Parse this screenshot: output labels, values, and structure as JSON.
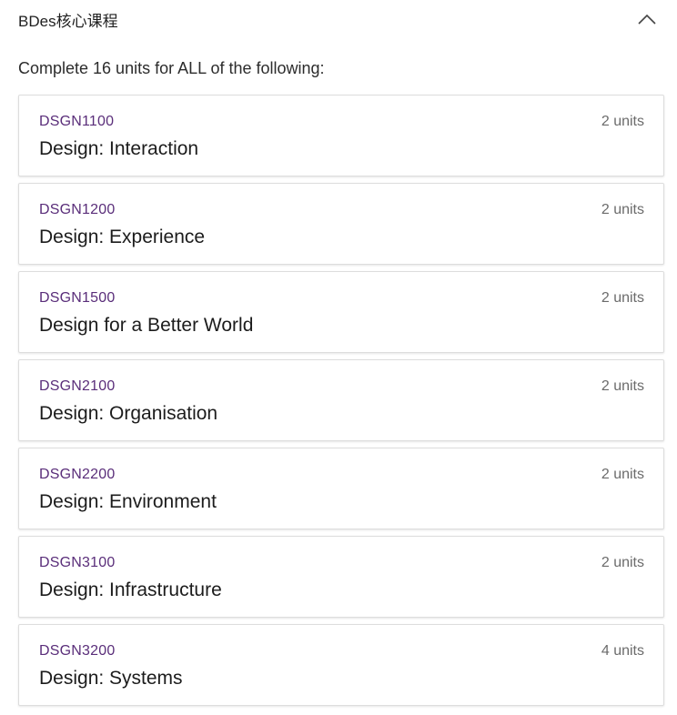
{
  "section": {
    "title": "BDes核心课程",
    "toggle_icon": "chevron-up-icon"
  },
  "intro_text": "Complete 16 units for ALL of the following:",
  "colors": {
    "course_code": "#5a2e7a",
    "units": "#6b6b6b",
    "card_border": "#dddddd"
  },
  "courses": [
    {
      "code": "DSGN1100",
      "name": "Design: Interaction",
      "units": "2 units"
    },
    {
      "code": "DSGN1200",
      "name": "Design: Experience",
      "units": "2 units"
    },
    {
      "code": "DSGN1500",
      "name": "Design for a Better World",
      "units": "2 units"
    },
    {
      "code": "DSGN2100",
      "name": "Design: Organisation",
      "units": "2 units"
    },
    {
      "code": "DSGN2200",
      "name": "Design: Environment",
      "units": "2 units"
    },
    {
      "code": "DSGN3100",
      "name": "Design: Infrastructure",
      "units": "2 units"
    },
    {
      "code": "DSGN3200",
      "name": "Design: Systems",
      "units": "4 units"
    }
  ]
}
